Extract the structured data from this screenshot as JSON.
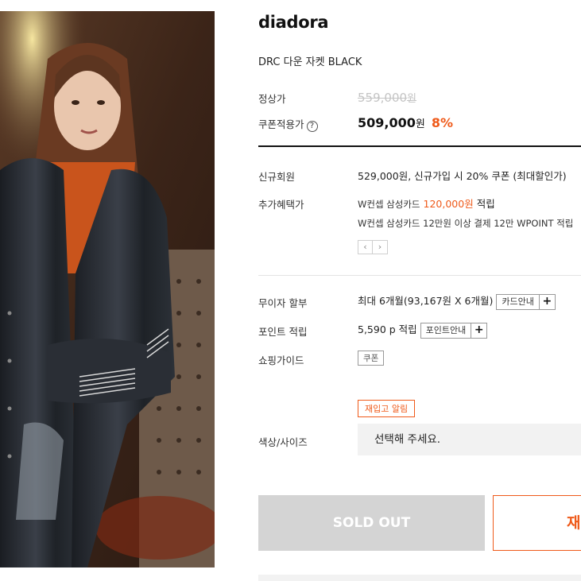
{
  "product": {
    "brand": "diadora",
    "name": "DRC 다운 자켓 BLACK",
    "image_alt": "Model wearing black down jacket over orange knit"
  },
  "price": {
    "regular_label": "정상가",
    "regular_value": "559,000",
    "regular_unit": "원",
    "coupon_label": "쿠폰적용가",
    "coupon_help": "?",
    "sale_value": "509,000",
    "sale_unit": "원",
    "discount": "8%"
  },
  "benefits": {
    "new_member_label": "신규회원",
    "new_member_text": "529,000원, 신규가입 시 20% 쿠폰 (최대할인가)",
    "extra_label": "추가혜택가",
    "extra_prefix": "W컨셉 삼성카드",
    "extra_amount": "120,000원",
    "extra_suffix": "적립",
    "extra_note": "W컨셉 삼성카드 12만원 이상 결제 12만 WPOINT 적립",
    "pager_prev": "‹",
    "pager_next": "›"
  },
  "installment": {
    "label": "무이자 할부",
    "text": "최대 6개월(93,167원 X 6개월)",
    "button": "카드안내",
    "plus": "+"
  },
  "points": {
    "label": "포인트 적립",
    "text": "5,590 p 적립",
    "button": "포인트안내",
    "plus": "+"
  },
  "shopping_guide": {
    "label": "쇼핑가이드",
    "tag": "쿠폰"
  },
  "options": {
    "restock_alert": "재입고 알림",
    "label": "색상/사이즈",
    "placeholder": "선택해 주세요."
  },
  "actions": {
    "sold_out": "SOLD OUT",
    "restock_button": "재입고 알림"
  },
  "colors": {
    "accent": "#ef5a1a",
    "sold_out_bg": "#d4d4d4"
  }
}
